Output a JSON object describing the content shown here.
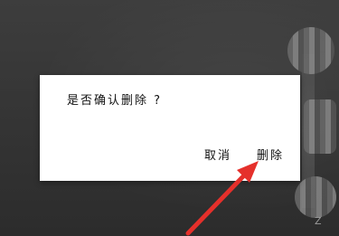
{
  "dialog": {
    "message": "是否确认删除 ?",
    "cancel_label": "取消",
    "delete_label": "删除"
  },
  "annotation": {
    "arrow_color": "#e5302b"
  },
  "background": {
    "corner_glyph": "Z"
  }
}
